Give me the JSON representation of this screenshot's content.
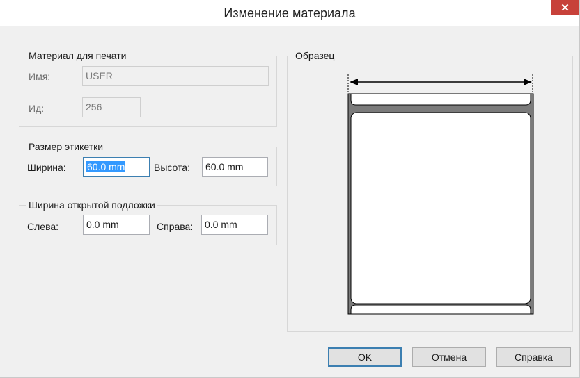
{
  "window": {
    "title": "Изменение материала",
    "close_glyph": "✕"
  },
  "material": {
    "legend": "Материал для печати",
    "name_label": "Имя:",
    "name_value": "USER",
    "id_label": "Ид:",
    "id_value": "256"
  },
  "label_size": {
    "legend": "Размер этикетки",
    "width_label": "Ширина:",
    "width_value": "60.0 mm",
    "height_label": "Высота:",
    "height_value": "60.0 mm"
  },
  "liner": {
    "legend": "Ширина открытой подложки",
    "left_label": "Слева:",
    "left_value": "0.0 mm",
    "right_label": "Справа:",
    "right_value": "0.0 mm"
  },
  "sample": {
    "legend": "Образец"
  },
  "buttons": {
    "ok": "OK",
    "cancel": "Отмена",
    "help": "Справка"
  }
}
